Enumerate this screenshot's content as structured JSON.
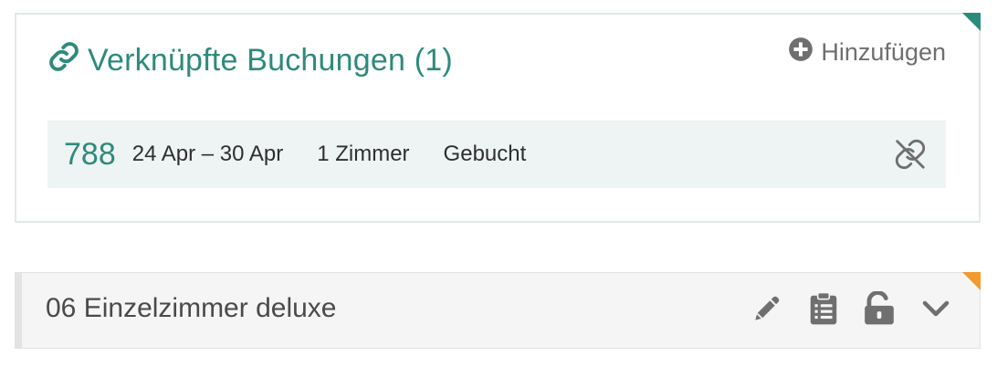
{
  "linked_bookings": {
    "title": "Verknüpfte Buchungen (1)",
    "add_label": "Hinzufügen",
    "bookings": [
      {
        "id": "788",
        "dates": "24 Apr – 30 Apr",
        "rooms": "1 Zimmer",
        "status": "Gebucht"
      }
    ]
  },
  "room": {
    "name": "06 Einzelzimmer deluxe"
  },
  "icons": {
    "title": "link-icon",
    "add": "plus-circle-icon",
    "unlink": "unlink-icon",
    "edit": "pencil-icon",
    "notes": "clipboard-icon",
    "lock": "unlock-icon",
    "expand": "chevron-down-icon"
  },
  "colors": {
    "accent_teal": "#2e8a7c",
    "corner_teal": "#2a8a7b",
    "corner_orange": "#f29a2e",
    "row_bg": "#eef3f3",
    "icon_gray": "#6f6f6f"
  }
}
